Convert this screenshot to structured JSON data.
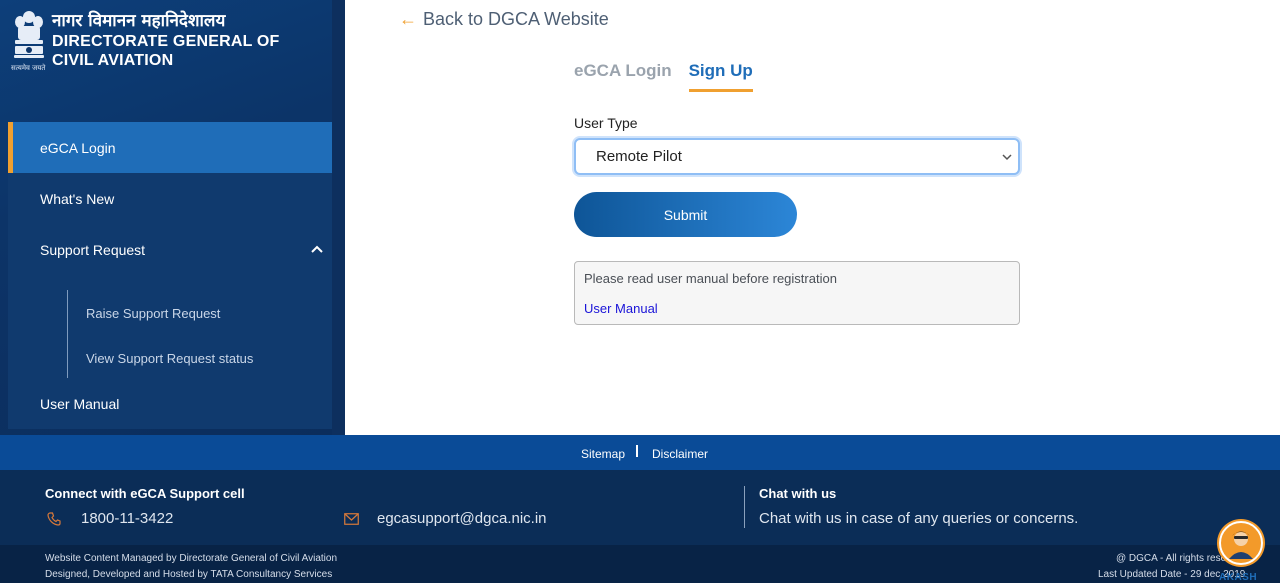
{
  "brand": {
    "hindi": "नागर विमानन महानिदेशालय",
    "line1": "DIRECTORATE GENERAL OF",
    "line2": "CIVIL AVIATION",
    "motto": "सत्यमेव जयते"
  },
  "sidebar": {
    "items": [
      {
        "label": "eGCA Login",
        "active": true
      },
      {
        "label": "What's New"
      },
      {
        "label": "Support Request",
        "expanded": true
      },
      {
        "label": "User Manual"
      }
    ],
    "support_sub": [
      "Raise Support Request",
      "View Support Request status"
    ]
  },
  "main": {
    "back_link": "Back to DGCA Website",
    "tabs": [
      {
        "label": "eGCA Login",
        "active": false
      },
      {
        "label": "Sign Up",
        "active": true
      }
    ],
    "user_type_label": "User Type",
    "user_type_value": "Remote Pilot",
    "submit_label": "Submit",
    "notice_text": "Please read user manual before registration",
    "notice_link": "User Manual"
  },
  "footer": {
    "links": [
      "Sitemap",
      "Disclaimer"
    ],
    "contact_title": "Connect with eGCA Support cell",
    "phone": "1800-11-3422",
    "email": "egcasupport@dgca.nic.in",
    "chat_title": "Chat with us",
    "chat_text": "Chat with us in case of any queries or concerns.",
    "managed_by": "Website Content Managed by Directorate General of Civil Aviation",
    "hosted_by": "Designed, Developed and Hosted by TATA Consultancy Services",
    "rights": "@ DGCA - All rights reserv",
    "updated": "Last Updated Date - 29 dec 2019",
    "bot_label": "AKASH"
  },
  "colors": {
    "accent": "#f0a030",
    "primary": "#1f6db8",
    "sidebar_bg": "#0c3468",
    "footer_links_bg": "#0a4b97",
    "footer_contact_bg": "#0b2d57",
    "footer_bottom_bg": "#082346"
  }
}
